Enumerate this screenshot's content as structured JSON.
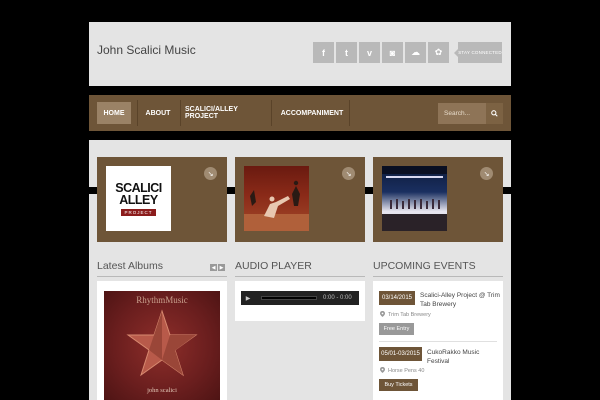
{
  "site": {
    "title": "John Scalici Music",
    "stay_connected": "STAY CONNECTED"
  },
  "social": [
    {
      "icon": "facebook-icon",
      "glyph": "f"
    },
    {
      "icon": "twitter-icon",
      "glyph": "t"
    },
    {
      "icon": "vimeo-icon",
      "glyph": "v"
    },
    {
      "icon": "instagram-icon",
      "glyph": "◙"
    },
    {
      "icon": "soundcloud-icon",
      "glyph": "☁"
    },
    {
      "icon": "reverbnation-icon",
      "glyph": "✿"
    }
  ],
  "nav": {
    "items": [
      "HOME",
      "ABOUT",
      "SCALICI/ALLEY PROJECT",
      "ACCOMPANIMENT"
    ],
    "active": "HOME",
    "search_placeholder": "Search..."
  },
  "cards": [
    {
      "name": "scalici-alley-project-logo",
      "logo_line1": "SCALICI",
      "logo_line2": "ALLEY",
      "logo_bar": "PROJECT"
    },
    {
      "name": "dance-performance-photo"
    },
    {
      "name": "stage-performance-photo"
    }
  ],
  "sections": {
    "albums": "Latest Albums",
    "audio": "AUDIO PLAYER",
    "events": "UPCOMING EVENTS"
  },
  "album": {
    "title": "RhythmMusic",
    "artist": "john scalici"
  },
  "player": {
    "time": "0:00 - 0:00"
  },
  "events": [
    {
      "date": "03/14/2015",
      "name": "Scalici-Alley Project @ Trim Tab Brewery",
      "location": "Trim Tab Brewery",
      "button": "Free Entry"
    },
    {
      "date": "05/01-03/2015",
      "name": "CukoRakko Music Festival",
      "location": "Horse Pens 40",
      "button": "Buy Tickets"
    }
  ],
  "colors": {
    "brown": "#6e5538",
    "active_nav": "#9a8266",
    "panel": "#e4e4e4",
    "icon_gray": "#b9b9b9"
  }
}
